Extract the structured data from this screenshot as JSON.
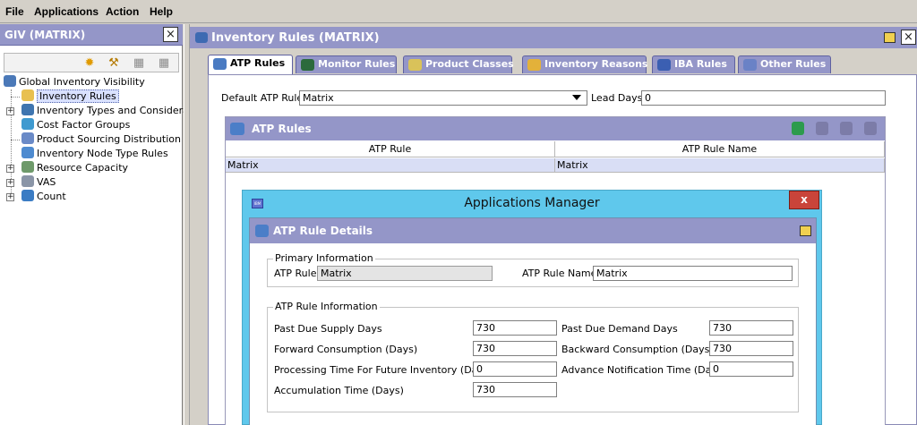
{
  "menu": {
    "file": "File",
    "applications": "Applications",
    "action": "Action",
    "help": "Help"
  },
  "left_panel": {
    "title": "GIV (MATRIX)",
    "tree": [
      {
        "label": "Global Inventory Visibility"
      },
      {
        "label": "Inventory Rules"
      },
      {
        "label": "Inventory Types and Consideratio"
      },
      {
        "label": "Cost Factor Groups"
      },
      {
        "label": "Product Sourcing Distribution Gro"
      },
      {
        "label": "Inventory Node Type Rules"
      },
      {
        "label": "Resource Capacity"
      },
      {
        "label": "VAS"
      },
      {
        "label": "Count"
      }
    ]
  },
  "main": {
    "title": "Inventory Rules (MATRIX)",
    "tabs": [
      {
        "label": "ATP Rules"
      },
      {
        "label": "Monitor Rules"
      },
      {
        "label": "Product Classes"
      },
      {
        "label": "Inventory Reasons"
      },
      {
        "label": "IBA Rules"
      },
      {
        "label": "Other Rules"
      }
    ],
    "default_atp_rule_label": "Default ATP Rule",
    "default_atp_rule_value": "Matrix",
    "lead_days_label": "Lead Days",
    "lead_days_value": "0",
    "atp_rules": {
      "title": "ATP Rules",
      "columns": [
        "ATP Rule",
        "ATP Rule Name"
      ],
      "rows": [
        [
          "Matrix",
          "Matrix"
        ]
      ]
    }
  },
  "dialog": {
    "window_title": "Applications Manager",
    "close": "x",
    "header": "ATP Rule Details",
    "primary_info": {
      "legend": "Primary Information",
      "atp_rule_label": "ATP Rule",
      "atp_rule_value": "Matrix",
      "atp_rule_name_label": "ATP Rule Name",
      "atp_rule_name_value": "Matrix"
    },
    "rule_info": {
      "legend": "ATP Rule Information",
      "past_due_supply_label": "Past Due Supply Days",
      "past_due_supply_value": "730",
      "past_due_demand_label": "Past Due Demand Days",
      "past_due_demand_value": "730",
      "forward_consumption_label": "Forward Consumption (Days)",
      "forward_consumption_value": "730",
      "backward_consumption_label": "Backward Consumption (Days)",
      "backward_consumption_value": "730",
      "processing_time_label": "Processing Time For Future Inventory (Days)",
      "processing_time_value": "0",
      "advance_notification_label": "Advance Notification Time (Days)",
      "advance_notification_value": "0",
      "accumulation_time_label": "Accumulation Time (Days)",
      "accumulation_time_value": "730"
    }
  }
}
